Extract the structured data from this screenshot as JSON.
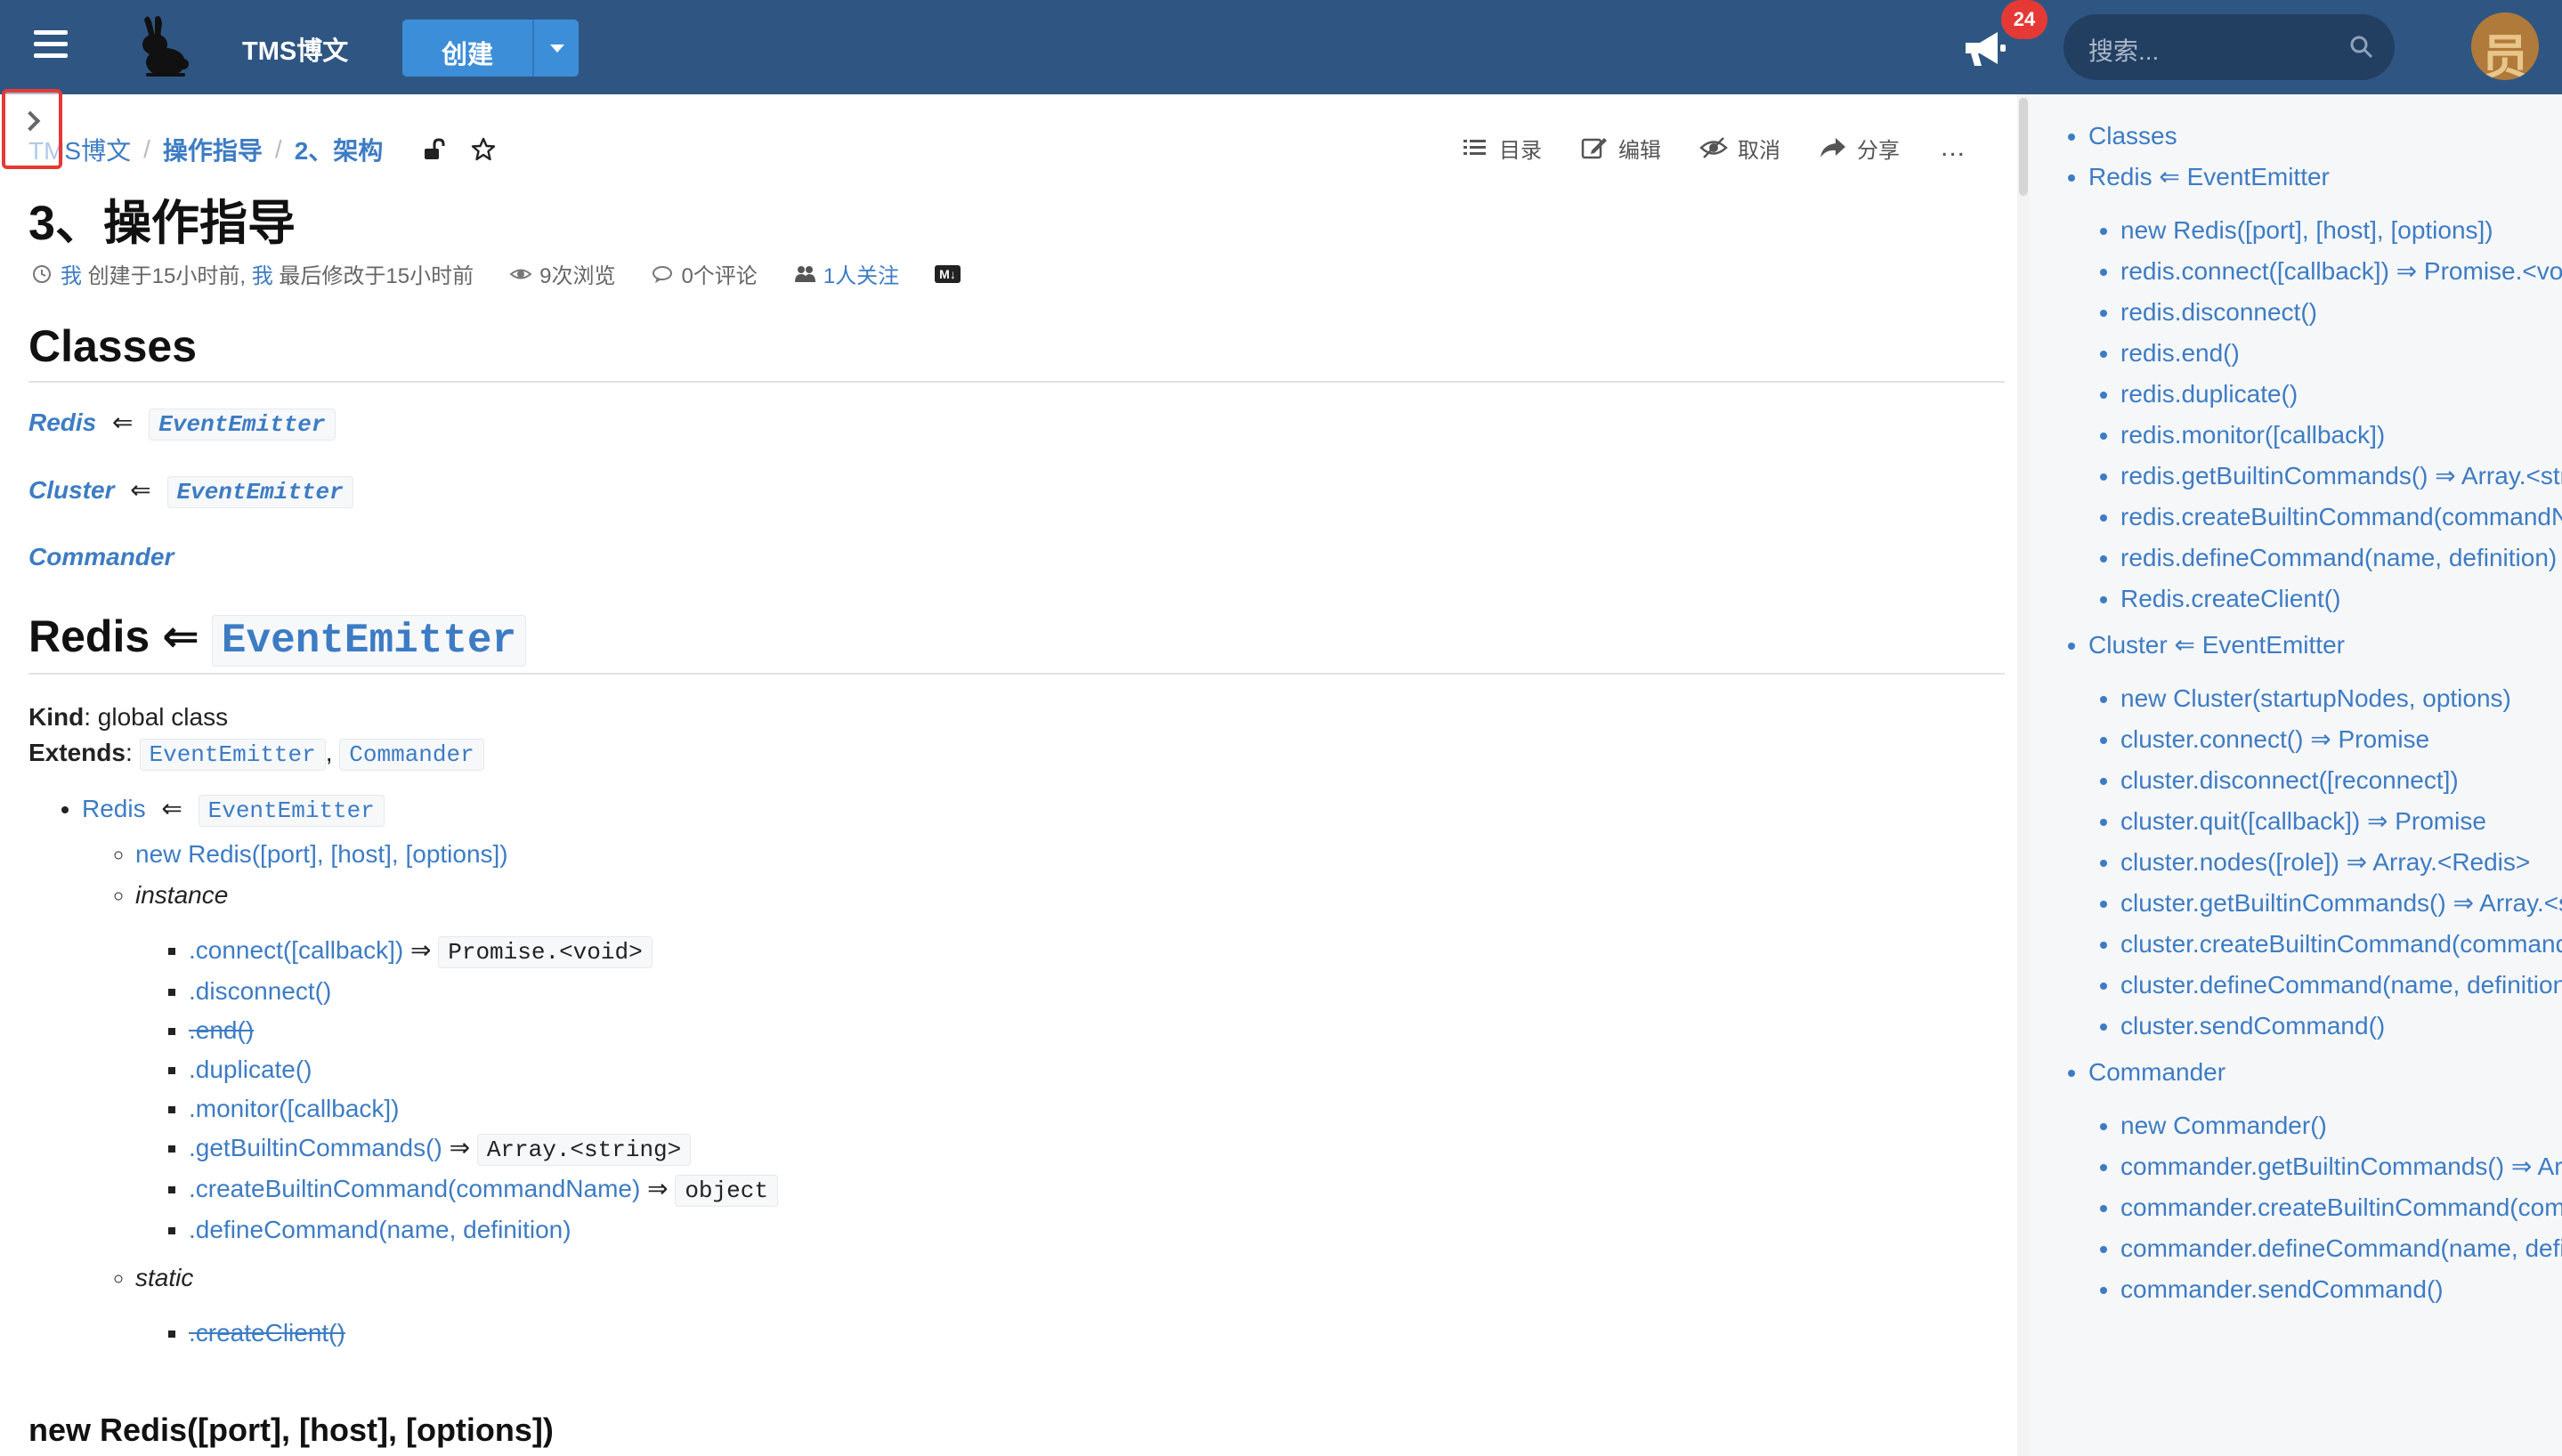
{
  "topbar": {
    "brand": "TMS博文",
    "create_label": "创建",
    "notification_count": "24",
    "search_placeholder": "搜索...",
    "avatar_text": "员"
  },
  "breadcrumb": {
    "items": [
      "TMS博文",
      "操作指导",
      "2、架构"
    ]
  },
  "actions": {
    "toc": "目录",
    "edit": "编辑",
    "cancel": "取消",
    "share": "分享",
    "more": "..."
  },
  "page": {
    "title": "3、操作指导",
    "meta": {
      "creator": "我",
      "created": "创建于15小时前,",
      "modifier": "我",
      "modified": "最后修改于15小时前",
      "views": "9次浏览",
      "comments": "0个评论",
      "followers": "1人关注",
      "md_badge": "M↓"
    }
  },
  "content": {
    "classes_heading": "Classes",
    "arrow": "⇐",
    "classes": [
      {
        "name": "Redis",
        "parent": "EventEmitter"
      },
      {
        "name": "Cluster",
        "parent": "EventEmitter"
      },
      {
        "name": "Commander",
        "parent": ""
      }
    ],
    "redis_heading": {
      "name": "Redis",
      "parent": "EventEmitter"
    },
    "kind_label": "Kind",
    "kind_value": ": global class",
    "extends_label": "Extends",
    "extends_sep": ":",
    "extends": [
      "EventEmitter",
      "Commander"
    ],
    "extends_comma": ",",
    "tree": {
      "root": "Redis",
      "root_parent": "EventEmitter",
      "ctor": "new Redis([port], [host], [options])",
      "instance_label": "instance",
      "instance": [
        {
          "text": ".connect([callback])",
          "ret": "Promise.<void>",
          "strike": false
        },
        {
          "text": ".disconnect()",
          "ret": "",
          "strike": false
        },
        {
          "text": ".end()",
          "ret": "",
          "strike": true
        },
        {
          "text": ".duplicate()",
          "ret": "",
          "strike": false
        },
        {
          "text": ".monitor([callback])",
          "ret": "",
          "strike": false
        },
        {
          "text": ".getBuiltinCommands()",
          "ret": "Array.<string>",
          "strike": false
        },
        {
          "text": ".createBuiltinCommand(commandName)",
          "ret": "object",
          "strike": false
        },
        {
          "text": ".defineCommand(name, definition)",
          "ret": "",
          "strike": false
        }
      ],
      "static_label": "static",
      "static": [
        {
          "text": ".createClient()",
          "strike": true
        }
      ]
    },
    "ret_arrow": "⇒",
    "subheading": "new Redis([port], [host], [options])"
  },
  "toc": {
    "classes": "Classes",
    "redis": "Redis ⇐ EventEmitter",
    "redis_items": [
      "new Redis([port], [host], [options])",
      "redis.connect([callback]) ⇒ Promise.<void>",
      "redis.disconnect()",
      "redis.end()",
      "redis.duplicate()",
      "redis.monitor([callback])",
      "redis.getBuiltinCommands() ⇒ Array.<string>",
      "redis.createBuiltinCommand(commandName)",
      "redis.defineCommand(name, definition)",
      "Redis.createClient()"
    ],
    "cluster": "Cluster ⇐ EventEmitter",
    "cluster_items": [
      "new Cluster(startupNodes, options)",
      "cluster.connect() ⇒ Promise",
      "cluster.disconnect([reconnect])",
      "cluster.quit([callback]) ⇒ Promise",
      "cluster.nodes([role]) ⇒ Array.<Redis>",
      "cluster.getBuiltinCommands() ⇒ Array.<string>",
      "cluster.createBuiltinCommand(commandName)",
      "cluster.defineCommand(name, definition)",
      "cluster.sendCommand()"
    ],
    "commander": "Commander",
    "commander_items": [
      "new Commander()",
      "commander.getBuiltinCommands() ⇒ Array.<string>",
      "commander.createBuiltinCommand(commandName)",
      "commander.defineCommand(name, definition)",
      "commander.sendCommand()"
    ]
  },
  "colors": {
    "topbar": "#2f5683",
    "accent": "#3d8ed8",
    "link": "#3d7cc4",
    "badge": "#e53935"
  }
}
